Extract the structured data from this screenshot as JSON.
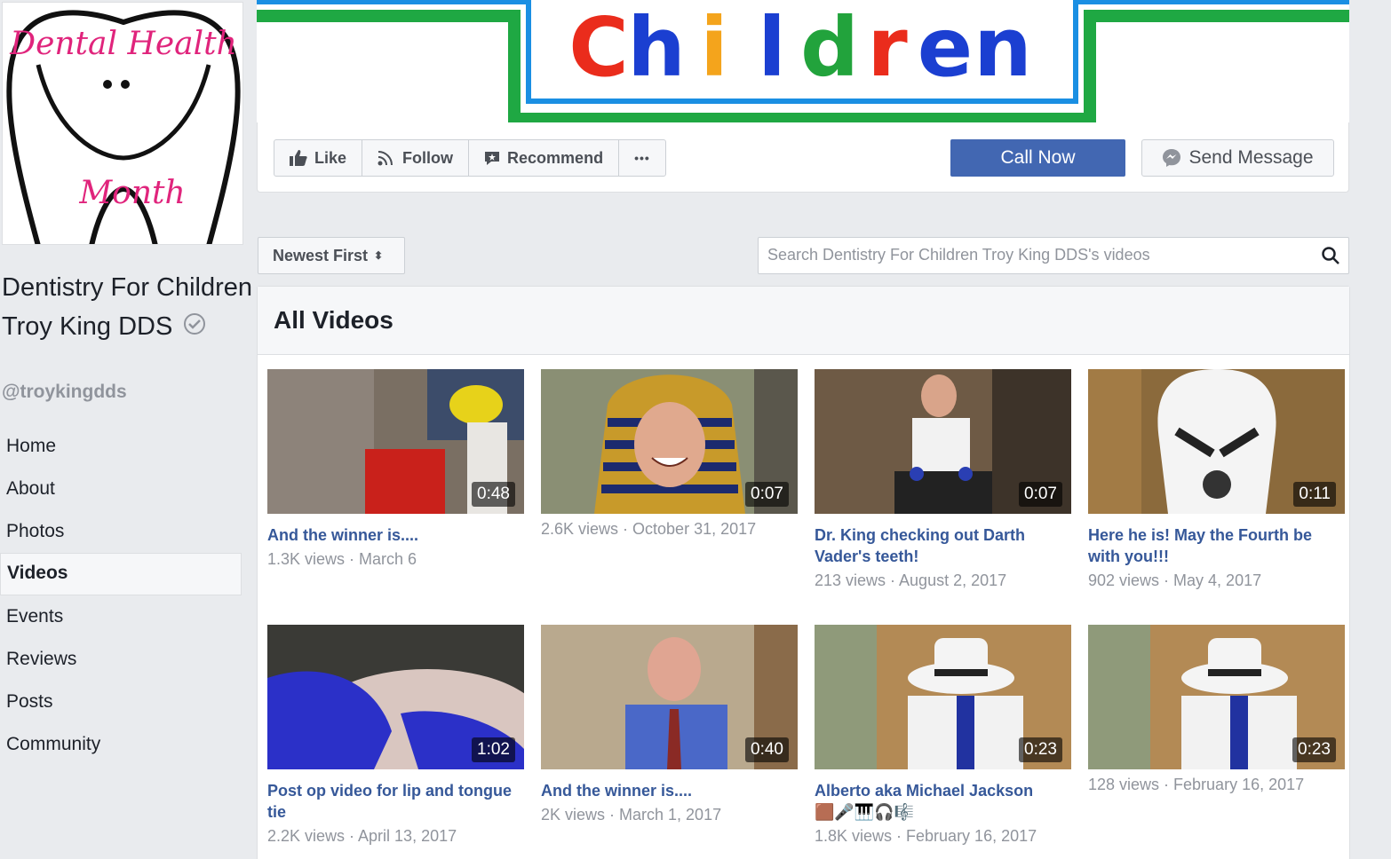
{
  "profile": {
    "logo_text_top": "Dental Health",
    "logo_text_bottom": "Month",
    "page_name": "Dentistry For Children Troy King DDS",
    "handle": "@troykingdds"
  },
  "nav": {
    "items": [
      {
        "label": "Home"
      },
      {
        "label": "About"
      },
      {
        "label": "Photos"
      },
      {
        "label": "Videos",
        "active": true
      },
      {
        "label": "Events"
      },
      {
        "label": "Reviews"
      },
      {
        "label": "Posts"
      },
      {
        "label": "Community"
      }
    ]
  },
  "cover": {
    "letters": [
      "C",
      "h",
      "i",
      "l",
      "d",
      "r",
      "e",
      "n"
    ],
    "letter_colors": [
      "#ea2c1c",
      "#1b3fd1",
      "#f4a41c",
      "#1b3fd1",
      "#22a33c",
      "#ea2c1c",
      "#1b3fd1",
      "#1b3fd1"
    ]
  },
  "actions": {
    "like": "Like",
    "follow": "Follow",
    "recommend": "Recommend",
    "more": "•••",
    "call_now": "Call Now",
    "send_message": "Send Message"
  },
  "toolbar": {
    "sort_label": "Newest First",
    "search_placeholder": "Search Dentistry For Children Troy King DDS's videos"
  },
  "videos": {
    "heading": "All Videos",
    "items": [
      {
        "duration": "0:48",
        "title": "And the winner is....",
        "meta": "1.3K views · March 6"
      },
      {
        "duration": "0:07",
        "title": "",
        "meta": "2.6K views · October 31, 2017"
      },
      {
        "duration": "0:07",
        "title": "Dr. King checking out Darth Vader's teeth!",
        "meta": "213 views · August 2, 2017"
      },
      {
        "duration": "0:11",
        "title": "Here he is! May the Fourth be with you!!!",
        "meta": "902 views · May 4, 2017"
      },
      {
        "duration": "1:02",
        "title": "Post op video for lip and tongue tie",
        "meta": "2.2K views · April 13, 2017"
      },
      {
        "duration": "0:40",
        "title": "And the winner is....",
        "meta": "2K views · March 1, 2017"
      },
      {
        "duration": "0:23",
        "title": "Alberto aka Michael Jackson",
        "emojis": "🟫🎤🎹🎧🎼",
        "meta": "1.8K views · February 16, 2017"
      },
      {
        "duration": "0:23",
        "title": "",
        "meta": "128 views · February 16, 2017"
      }
    ]
  },
  "colors": {
    "link_blue": "#365899",
    "primary_button": "#4267b2",
    "muted_text": "#90949c",
    "page_bg": "#e9ebee"
  }
}
